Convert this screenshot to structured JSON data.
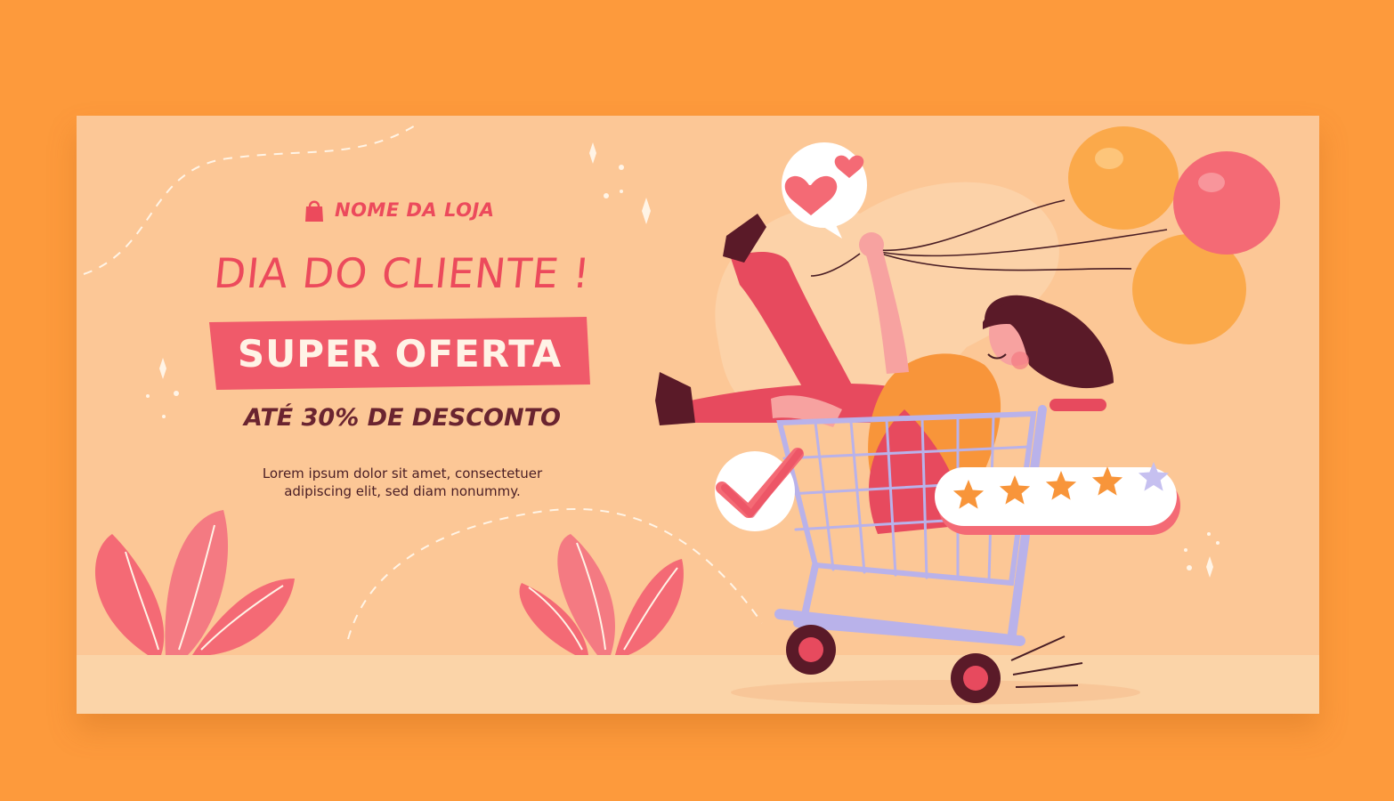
{
  "store": {
    "name": "NOME DA LOJA",
    "icon": "shopping-bag-icon"
  },
  "headline": "DIA DO CLIENTE !",
  "offer": "SUPER OFERTA",
  "discount": "ATÉ 30% DE DESCONTO",
  "body_text_line1": "Lorem ipsum dolor sit amet, consectetuer",
  "body_text_line2": "adipiscing elit, sed diam nonummy.",
  "rating": {
    "stars_filled": 4,
    "stars_total": 5
  },
  "colors": {
    "outer_background": "#fd9a3c",
    "banner_background": "#fcc796",
    "accent_red": "#ec4a5c",
    "dark_text": "#6a2430",
    "cart_lilac": "#b9b2ea",
    "balloon_orange": "#fba94a"
  }
}
